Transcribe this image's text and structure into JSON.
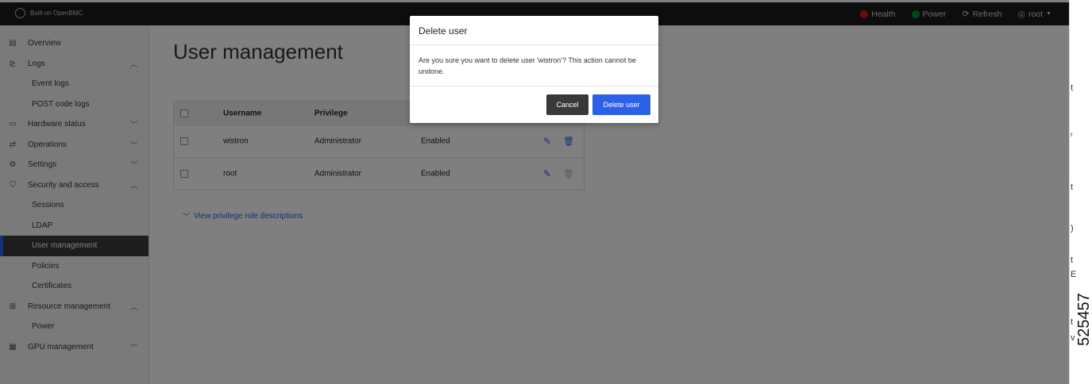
{
  "topbar": {
    "brand": "Built on OpenBMC",
    "health": "Health",
    "power": "Power",
    "refresh": "Refresh",
    "user": "root"
  },
  "sidebar": {
    "items": [
      {
        "label": "Overview",
        "icon": "overview-icon",
        "chevron": ""
      },
      {
        "label": "Logs",
        "icon": "logs-icon",
        "chevron": "up"
      },
      {
        "label": "Event logs",
        "sub": true
      },
      {
        "label": "POST code logs",
        "sub": true
      },
      {
        "label": "Hardware status",
        "icon": "hardware-icon",
        "chevron": "down"
      },
      {
        "label": "Operations",
        "icon": "operations-icon",
        "chevron": "down"
      },
      {
        "label": "Settings",
        "icon": "settings-icon",
        "chevron": "down"
      },
      {
        "label": "Security and access",
        "icon": "security-icon",
        "chevron": "up"
      },
      {
        "label": "Sessions",
        "sub": true
      },
      {
        "label": "LDAP",
        "sub": true
      },
      {
        "label": "User management",
        "sub": true,
        "active": true
      },
      {
        "label": "Policies",
        "sub": true
      },
      {
        "label": "Certificates",
        "sub": true
      },
      {
        "label": "Resource management",
        "icon": "resource-icon",
        "chevron": "up"
      },
      {
        "label": "Power",
        "sub": true
      },
      {
        "label": "GPU management",
        "icon": "gpu-icon",
        "chevron": "down"
      }
    ]
  },
  "page": {
    "title": "User management"
  },
  "table": {
    "headers": [
      "Username",
      "Privilege"
    ],
    "rows": [
      {
        "username": "wistron",
        "privilege": "Administrator",
        "status": "Enabled",
        "can_delete": true
      },
      {
        "username": "root",
        "privilege": "Administrator",
        "status": "Enabled",
        "can_delete": false
      }
    ]
  },
  "link": {
    "label": "View privilege role descriptions"
  },
  "modal": {
    "title": "Delete user",
    "body": "Are you sure you want to delete user 'wistron'? This action cannot be undone.",
    "cancel": "Cancel",
    "confirm": "Delete user"
  },
  "edge": {
    "chars": [
      "t",
      "r",
      "t",
      ")",
      "t",
      "E",
      "t",
      "v"
    ],
    "figure_id": "525457"
  },
  "colors": {
    "accent": "#2d60e8",
    "topbar": "#1a1a1a",
    "health": "#da1416",
    "power": "#0a8a2e"
  }
}
